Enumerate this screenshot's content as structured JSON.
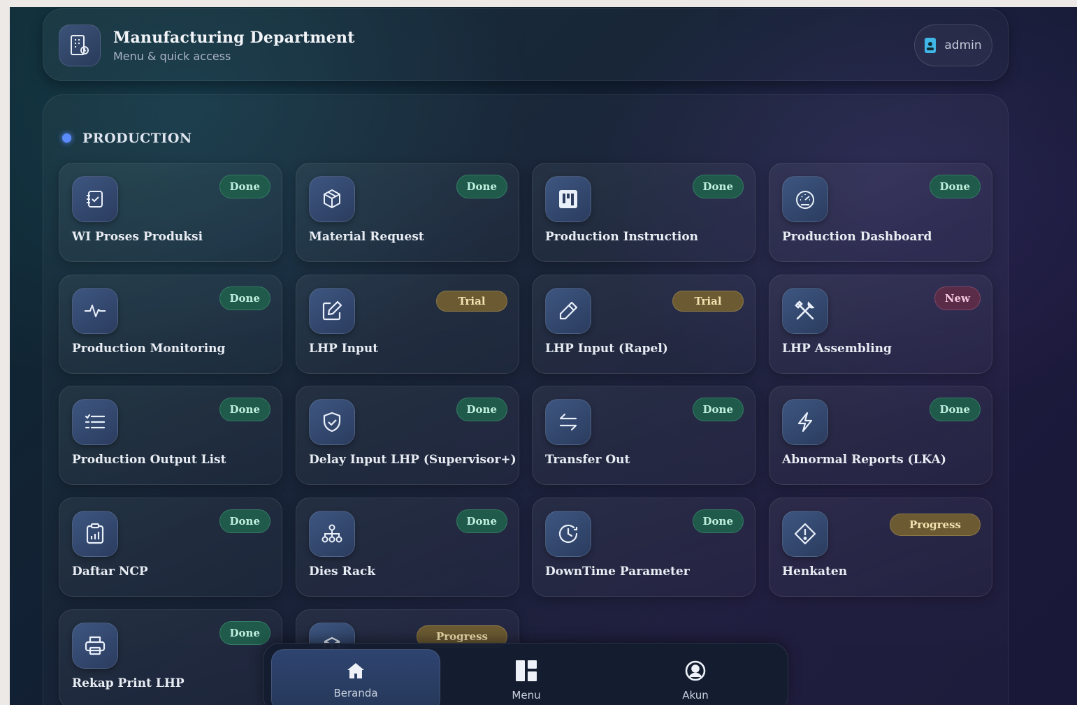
{
  "header": {
    "title": "Manufacturing Department",
    "subtitle": "Menu & quick access",
    "user": "admin"
  },
  "section": {
    "title": "PRODUCTION"
  },
  "cards": [
    {
      "label": "WI Proses Produksi",
      "status": "Done",
      "icon": "checklist-icon"
    },
    {
      "label": "Material Request",
      "status": "Done",
      "icon": "box-icon"
    },
    {
      "label": "Production Instruction",
      "status": "Done",
      "icon": "kanban-icon"
    },
    {
      "label": "Production Dashboard",
      "status": "Done",
      "icon": "gauge-icon"
    },
    {
      "label": "Production Monitoring",
      "status": "Done",
      "icon": "pulse-icon"
    },
    {
      "label": "LHP Input",
      "status": "Trial",
      "icon": "edit-icon"
    },
    {
      "label": "LHP Input (Rapel)",
      "status": "Trial",
      "icon": "pencil-icon"
    },
    {
      "label": "LHP Assembling",
      "status": "New",
      "icon": "tools-icon"
    },
    {
      "label": "Production Output List",
      "status": "Done",
      "icon": "list-icon"
    },
    {
      "label": "Delay Input LHP (Supervisor+)",
      "status": "Done",
      "icon": "shield-check-icon"
    },
    {
      "label": "Transfer Out",
      "status": "Done",
      "icon": "transfer-icon"
    },
    {
      "label": "Abnormal Reports (LKA)",
      "status": "Done",
      "icon": "lightning-icon"
    },
    {
      "label": "Daftar NCP",
      "status": "Done",
      "icon": "clipboard-chart-icon"
    },
    {
      "label": "Dies Rack",
      "status": "Done",
      "icon": "hierarchy-icon"
    },
    {
      "label": "DownTime Parameter",
      "status": "Done",
      "icon": "clock-icon"
    },
    {
      "label": "Henkaten",
      "status": "Progress",
      "icon": "warning-diamond-icon"
    },
    {
      "label": "Rekap Print LHP",
      "status": "Done",
      "icon": "printer-icon"
    },
    {
      "label": "",
      "status": "Progress",
      "icon": "package-icon"
    }
  ],
  "nav": [
    {
      "label": "Beranda",
      "icon": "home-icon",
      "active": true
    },
    {
      "label": "Menu",
      "icon": "menu-grid-icon",
      "active": false
    },
    {
      "label": "Akun",
      "icon": "account-icon",
      "active": false
    }
  ],
  "colors": {
    "done_badge": "#1f5a4a",
    "trial_badge": "#6b5a32",
    "new_badge": "#5a2c48",
    "accent_dot": "#5b8cff"
  }
}
